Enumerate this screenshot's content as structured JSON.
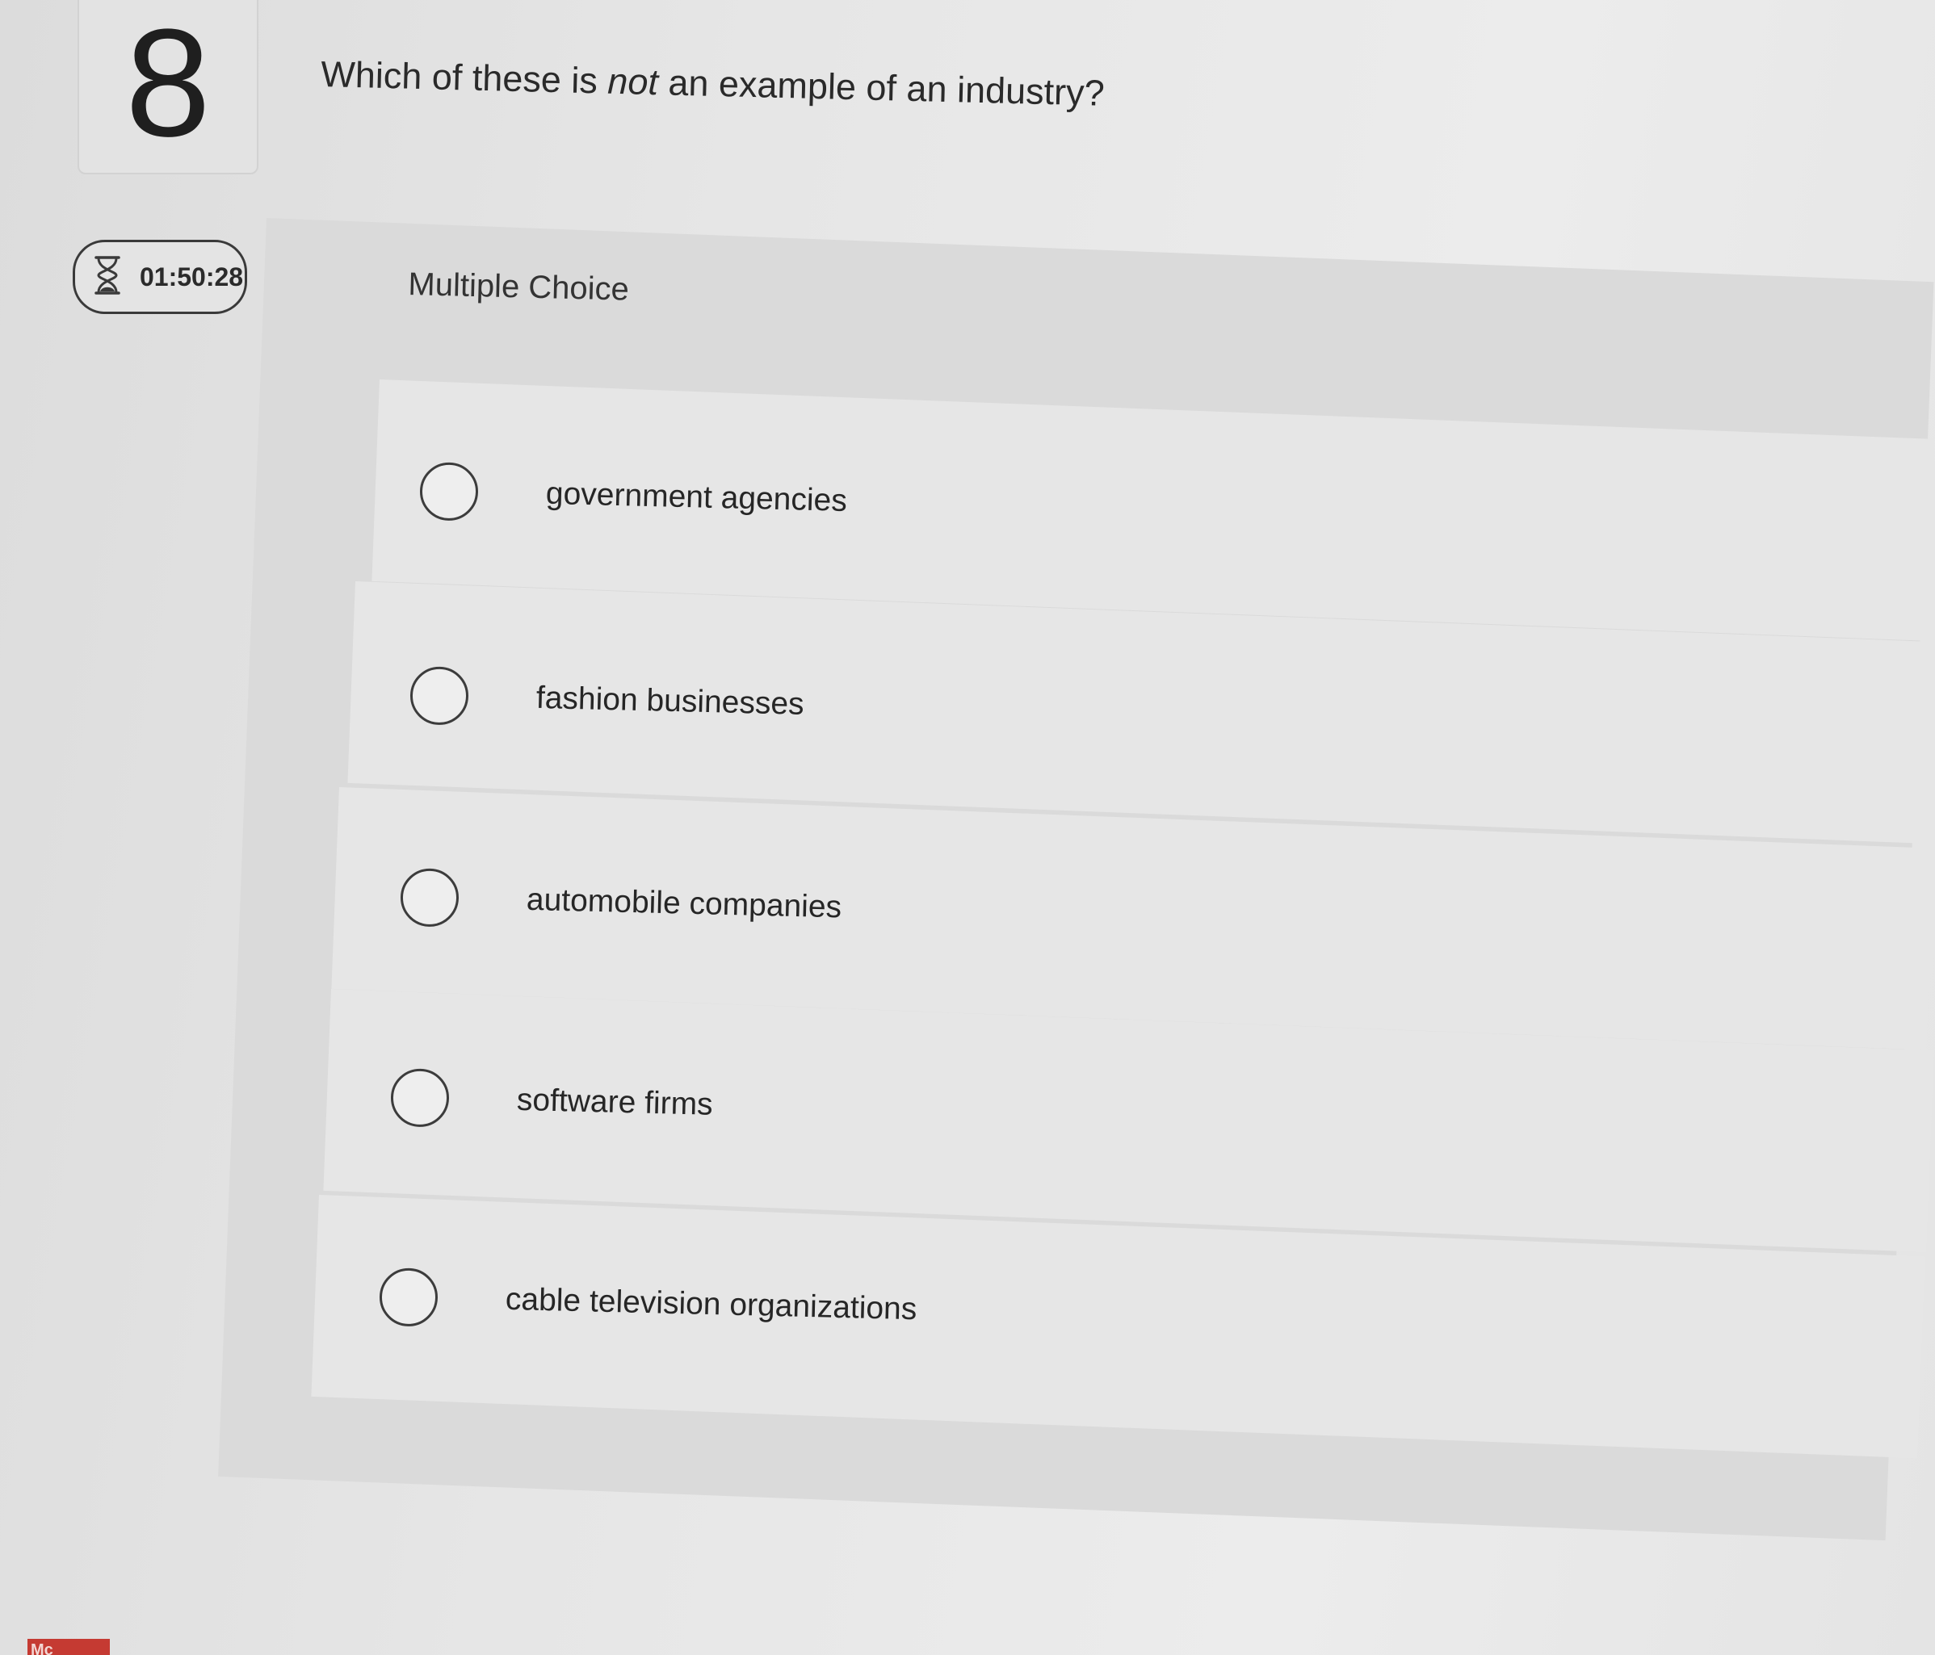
{
  "question": {
    "number": "8",
    "text_before": "Which of these is ",
    "text_emphasis": "not",
    "text_after": " an example of an industry?"
  },
  "timer": {
    "icon": "hourglass-icon",
    "value": "01:50:28"
  },
  "answer_area": {
    "type_label": "Multiple Choice",
    "options": [
      {
        "label": "government agencies",
        "selected": false
      },
      {
        "label": "fashion businesses",
        "selected": false
      },
      {
        "label": "automobile companies",
        "selected": false
      },
      {
        "label": "software firms",
        "selected": false
      },
      {
        "label": "cable television organizations",
        "selected": false
      }
    ]
  },
  "corner_logo": {
    "text": "Mc"
  }
}
